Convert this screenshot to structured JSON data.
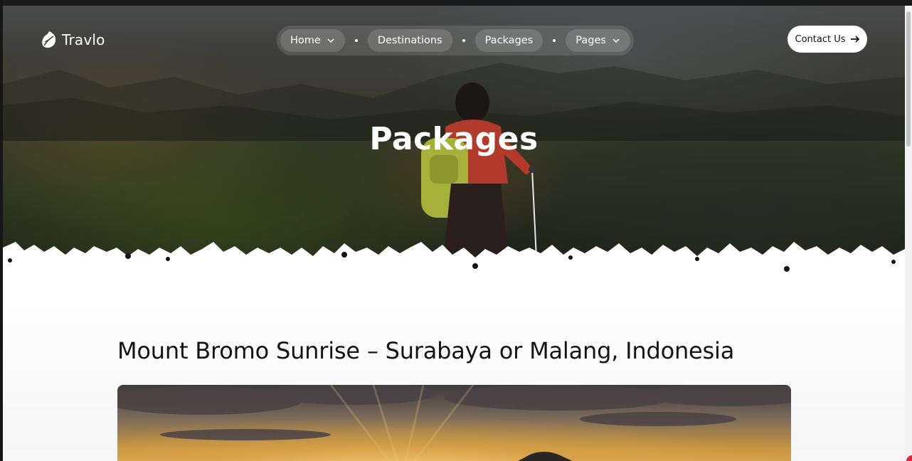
{
  "brand": {
    "name": "Travlo",
    "icon": "leaf-logo-icon"
  },
  "nav": {
    "items": [
      {
        "label": "Home",
        "has_dropdown": true
      },
      {
        "label": "Destinations",
        "has_dropdown": false
      },
      {
        "label": "Packages",
        "has_dropdown": false
      },
      {
        "label": "Pages",
        "has_dropdown": true
      }
    ]
  },
  "header": {
    "contact_label": "Contact Us",
    "contact_icon": "arrow-right-icon"
  },
  "hero": {
    "title": "Packages"
  },
  "main": {
    "package_title": "Mount Bromo Sunrise – Surabaya or Malang, Indonesia",
    "image_subject": "sunrise-over-volcano"
  },
  "colors": {
    "accent": "#e0283c",
    "text_dark": "#141414",
    "white": "#ffffff"
  }
}
